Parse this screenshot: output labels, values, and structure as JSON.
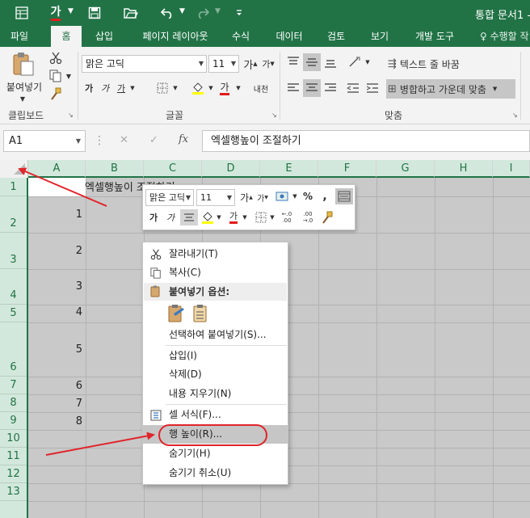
{
  "title_bar": {
    "doc_title": "통합 문서1 -",
    "font_color_glyph": "가",
    "icons": [
      "excel-icon",
      "font-color-icon",
      "save-icon",
      "open-icon",
      "undo-icon",
      "redo-icon",
      "customize-icon"
    ]
  },
  "ribbon_tabs": [
    "파일",
    "홈",
    "삽입",
    "페이지 레이아웃",
    "수식",
    "데이터",
    "검토",
    "보기",
    "개발 도구"
  ],
  "active_tab": "홈",
  "tell_me": "♀ 수행할 작",
  "ribbon": {
    "clipboard": {
      "label": "클립보드",
      "paste": "붙여넣기"
    },
    "font": {
      "label": "글꼴",
      "font_name": "맑은 고딕",
      "font_size": "11",
      "grow": "가",
      "shrink": "가",
      "bold": "가",
      "italic": "가",
      "underline": "가",
      "font_color": "가",
      "phonetic": "내천"
    },
    "alignment": {
      "label": "맞춤",
      "wrap_text": "텍스트 줄 바꿈",
      "merge_center": "병합하고 가운데 맞춤"
    }
  },
  "formula_bar": {
    "name_box": "A1",
    "cancel": "✕",
    "enter": "✓",
    "fx": "fx",
    "content": "엑셀행높이 조절하기"
  },
  "columns": [
    "A",
    "B",
    "C",
    "D",
    "E",
    "F",
    "G",
    "H",
    "I"
  ],
  "rows": [
    "1",
    "2",
    "3",
    "4",
    "5",
    "6",
    "7",
    "8",
    "9",
    "10",
    "11",
    "12",
    "13"
  ],
  "cells": {
    "B1": "엑셀행높이 조절하기",
    "A_values": [
      "1",
      "2",
      "3",
      "4",
      "5",
      "6",
      "7",
      "8"
    ]
  },
  "mini_toolbar": {
    "font_name": "맑은 고딕",
    "font_size": "11",
    "grow": "가",
    "shrink": "가",
    "percent": "%",
    "comma": ",",
    "bold": "가",
    "italic": "가",
    "font_color": "가",
    "inc_decimal": "←.0 .00",
    "dec_decimal": ".00 →.0"
  },
  "context_menu": {
    "cut": "잘라내기(T)",
    "copy": "복사(C)",
    "paste_options": "붙여넣기 옵션:",
    "paste_special": "선택하여 붙여넣기(S)...",
    "insert": "삽입(I)",
    "delete": "삭제(D)",
    "clear": "내용 지우기(N)",
    "format_cells": "셀 서식(F)...",
    "row_height": "행 높이(R)...",
    "hide": "숨기기(H)",
    "unhide": "숨기기 취소(U)"
  },
  "colors": {
    "excel_green": "#217346",
    "selection_header": "#d3e8dc",
    "selected_cells": "#c9c9c9",
    "annotation_red": "#e0252b",
    "highlight_yellow": "#ffff00",
    "font_red": "#e21b1b"
  }
}
